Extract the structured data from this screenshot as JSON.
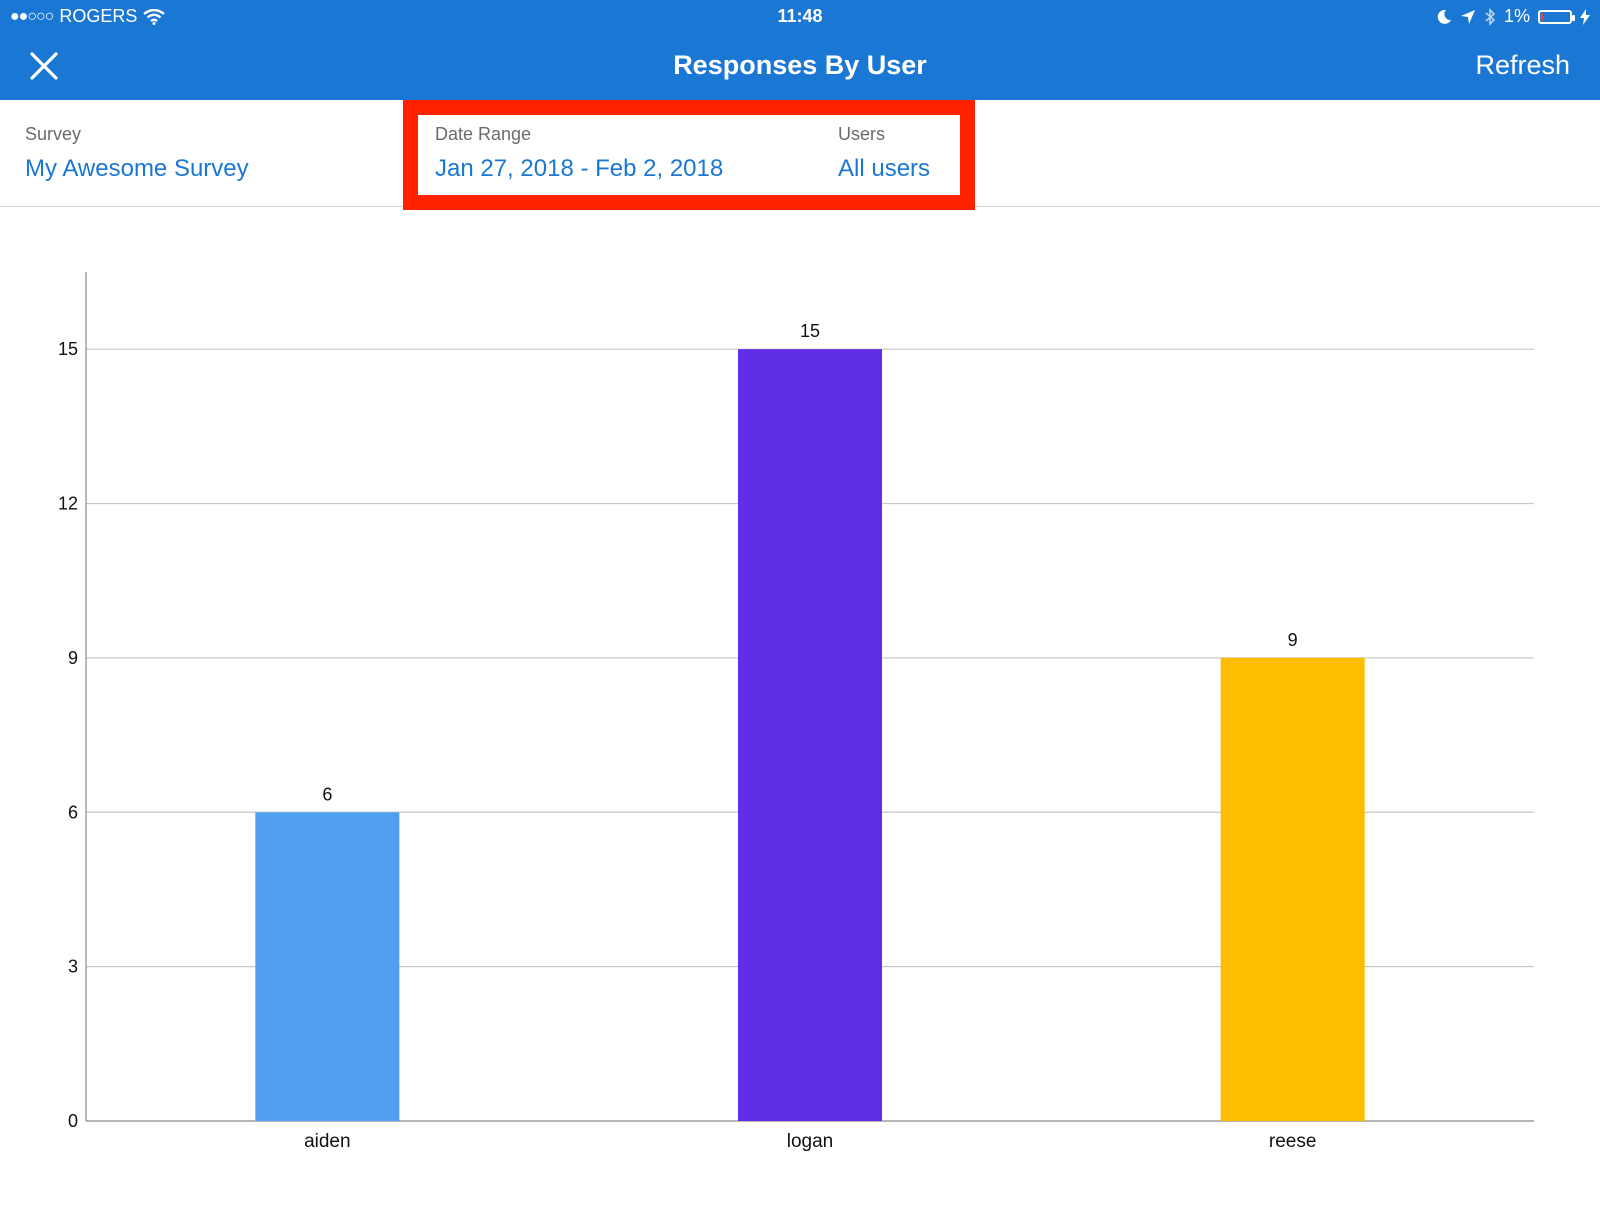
{
  "status_bar": {
    "signal": "●●○○○",
    "carrier": "ROGERS",
    "time": "11:48",
    "battery_text": "1%",
    "battery_level": 0.01,
    "battery_color": "#ff3b30",
    "icons": [
      "wifi-icon",
      "moon-icon",
      "location-arrow-icon",
      "bluetooth-icon",
      "battery-icon",
      "charging-bolt-icon"
    ]
  },
  "nav": {
    "title": "Responses By User",
    "refresh_label": "Refresh",
    "close_icon": "close-icon",
    "background": "#1b77d4"
  },
  "filters": {
    "survey": {
      "label": "Survey",
      "value": "My Awesome Survey"
    },
    "date_range": {
      "label": "Date Range",
      "value": "Jan 27, 2018 - Feb 2, 2018"
    },
    "users": {
      "label": "Users",
      "value": "All users"
    },
    "highlight_color": "#ff2200"
  },
  "chart_data": {
    "type": "bar",
    "categories": [
      "aiden",
      "logan",
      "reese"
    ],
    "values": [
      6,
      15,
      9
    ],
    "colors": [
      "#519ff2",
      "#612ee8",
      "#fdbd00"
    ],
    "title": "",
    "xlabel": "",
    "ylabel": "",
    "ylim": [
      0,
      16.5
    ],
    "yticks": [
      0,
      3,
      6,
      9,
      12,
      15
    ],
    "grid": true,
    "data_labels": true
  }
}
